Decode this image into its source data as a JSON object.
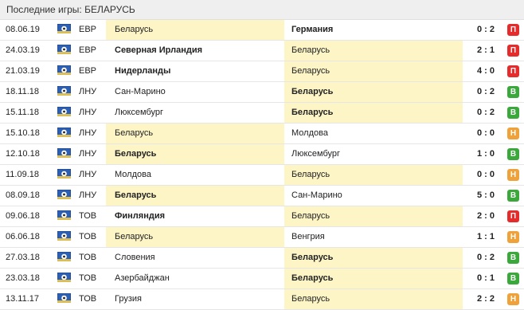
{
  "title": "Последние игры: БЕЛАРУСЬ",
  "icons": {
    "tournament": "ball-flag-icon"
  },
  "result_colors": {
    "П": "#e52b2b",
    "В": "#3aa83a",
    "Н": "#f0a23a"
  },
  "matches": [
    {
      "date": "08.06.19",
      "tour": "ЕВР",
      "home": "Беларусь",
      "away": "Германия",
      "winner": "away",
      "score": "0 : 2",
      "result": "П"
    },
    {
      "date": "24.03.19",
      "tour": "ЕВР",
      "home": "Северная Ирландия",
      "away": "Беларусь",
      "winner": "home",
      "score": "2 : 1",
      "result": "П"
    },
    {
      "date": "21.03.19",
      "tour": "ЕВР",
      "home": "Нидерланды",
      "away": "Беларусь",
      "winner": "home",
      "score": "4 : 0",
      "result": "П"
    },
    {
      "date": "18.11.18",
      "tour": "ЛНУ",
      "home": "Сан-Марино",
      "away": "Беларусь",
      "winner": "away",
      "score": "0 : 2",
      "result": "В"
    },
    {
      "date": "15.11.18",
      "tour": "ЛНУ",
      "home": "Люксембург",
      "away": "Беларусь",
      "winner": "away",
      "score": "0 : 2",
      "result": "В"
    },
    {
      "date": "15.10.18",
      "tour": "ЛНУ",
      "home": "Беларусь",
      "away": "Молдова",
      "winner": "draw",
      "score": "0 : 0",
      "result": "Н"
    },
    {
      "date": "12.10.18",
      "tour": "ЛНУ",
      "home": "Беларусь",
      "away": "Люксембург",
      "winner": "home",
      "score": "1 : 0",
      "result": "В"
    },
    {
      "date": "11.09.18",
      "tour": "ЛНУ",
      "home": "Молдова",
      "away": "Беларусь",
      "winner": "draw",
      "score": "0 : 0",
      "result": "Н"
    },
    {
      "date": "08.09.18",
      "tour": "ЛНУ",
      "home": "Беларусь",
      "away": "Сан-Марино",
      "winner": "home",
      "score": "5 : 0",
      "result": "В"
    },
    {
      "date": "09.06.18",
      "tour": "ТОВ",
      "home": "Финляндия",
      "away": "Беларусь",
      "winner": "home",
      "score": "2 : 0",
      "result": "П"
    },
    {
      "date": "06.06.18",
      "tour": "ТОВ",
      "home": "Беларусь",
      "away": "Венгрия",
      "winner": "draw",
      "score": "1 : 1",
      "result": "Н"
    },
    {
      "date": "27.03.18",
      "tour": "ТОВ",
      "home": "Словения",
      "away": "Беларусь",
      "winner": "away",
      "score": "0 : 2",
      "result": "В"
    },
    {
      "date": "23.03.18",
      "tour": "ТОВ",
      "home": "Азербайджан",
      "away": "Беларусь",
      "winner": "away",
      "score": "0 : 1",
      "result": "В"
    },
    {
      "date": "13.11.17",
      "tour": "ТОВ",
      "home": "Грузия",
      "away": "Беларусь",
      "winner": "draw",
      "score": "2 : 2",
      "result": "Н"
    }
  ]
}
